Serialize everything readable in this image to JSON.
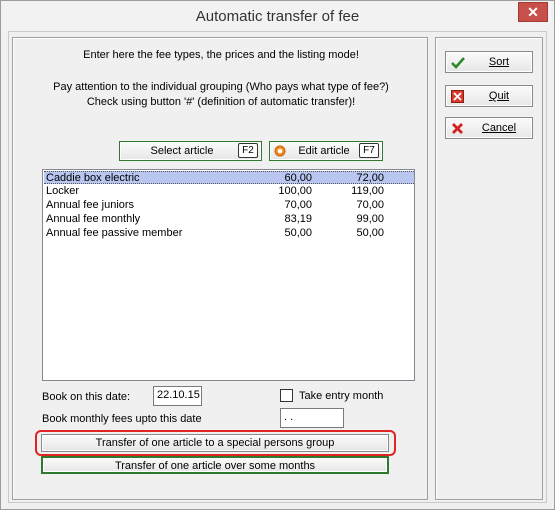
{
  "window": {
    "title": "Automatic transfer of fee",
    "close_glyph": "✕"
  },
  "info": {
    "line1": "Enter here the fee types, the prices and the listing mode!",
    "line2": "Pay attention to the individual grouping (Who pays what type of fee?)",
    "line3": "Check using button '#' (definition of automatic transfer)!"
  },
  "buttons": {
    "select_article": {
      "label": "Select article",
      "key": "F2"
    },
    "edit_article": {
      "label": "Edit article",
      "key": "F7"
    },
    "sort": "Sort",
    "quit": "Quit",
    "cancel": "Cancel",
    "transfer_group": "Transfer of one article to a special persons group",
    "transfer_months": "Transfer of one article over some months"
  },
  "articles": [
    {
      "name": "Caddie box electric",
      "price1": "60,00",
      "price2": "72,00",
      "selected": true
    },
    {
      "name": "Locker",
      "price1": "100,00",
      "price2": "119,00",
      "selected": false
    },
    {
      "name": "Annual fee juniors",
      "price1": "70,00",
      "price2": "70,00",
      "selected": false
    },
    {
      "name": "Annual fee monthly",
      "price1": "83,19",
      "price2": "99,00",
      "selected": false
    },
    {
      "name": "Annual fee passive member",
      "price1": "50,00",
      "price2": "50,00",
      "selected": false
    }
  ],
  "form": {
    "book_date_label": "Book on this date:",
    "book_date_value": "22.10.15",
    "take_entry_month_label": "Take entry month",
    "take_entry_month_checked": false,
    "monthly_fees_label": "Book monthly fees upto this date",
    "monthly_fees_value": " .  ."
  },
  "colors": {
    "selection": "#b8c6f0",
    "highlight": "#e02424",
    "close_button": "#c7504a"
  }
}
